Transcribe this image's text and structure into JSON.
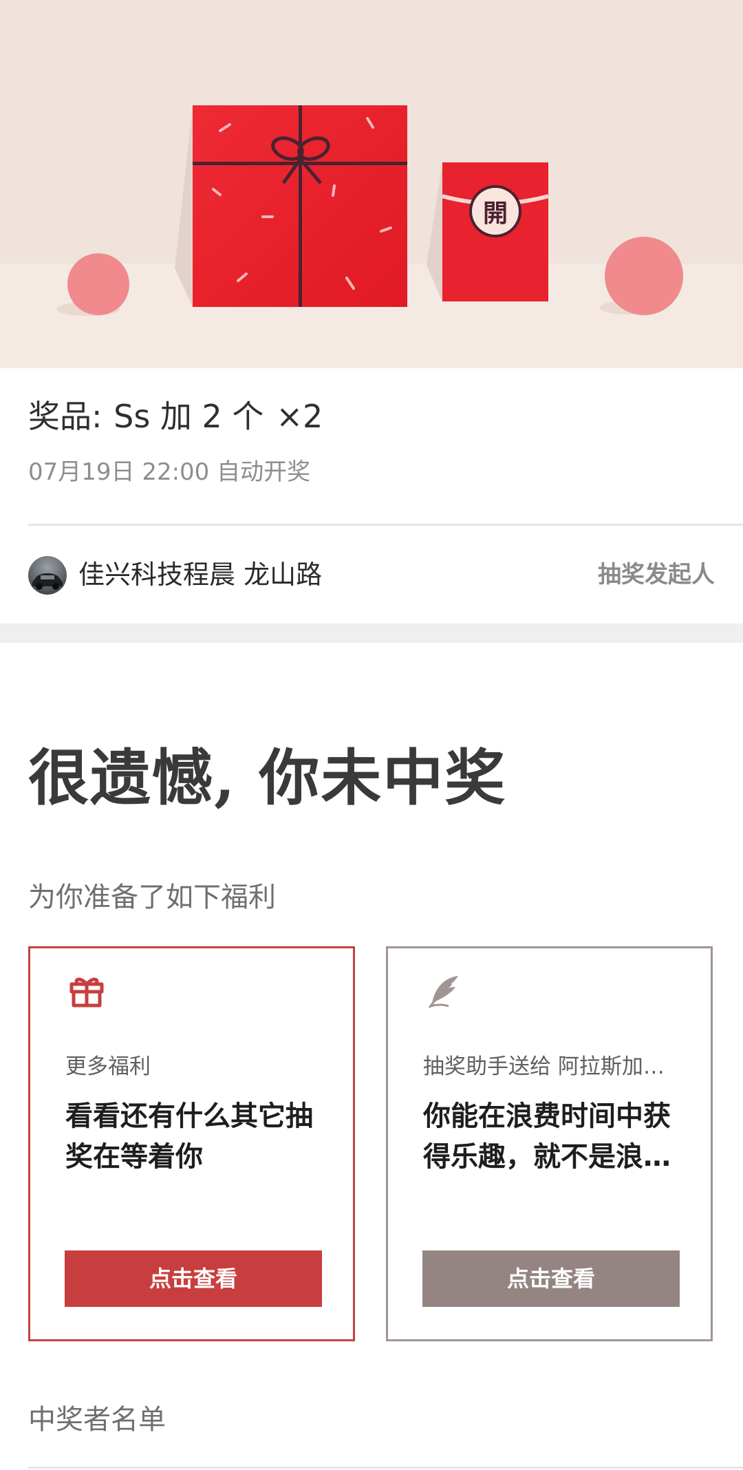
{
  "hero": {
    "red_packet_char": "開",
    "colors": {
      "background": "#efe3dc",
      "floor": "#f4e9e3",
      "gift_red": "#e8222e",
      "ribbon": "#4a2230",
      "ball_pink": "#f08a8c"
    }
  },
  "prize": {
    "label": "奖品",
    "separator": ":",
    "name": "Ss 加 2 个",
    "quantity": "×2",
    "draw_time": "07月19日 22:00 自动开奖"
  },
  "sponsor": {
    "name": "佳兴科技程晨 龙山路",
    "role": "抽奖发起人"
  },
  "result": {
    "heading": "很遗憾, 你未中奖",
    "benefits_subtitle": "为你准备了如下福利"
  },
  "cards": [
    {
      "icon": "gift-icon",
      "label": "更多福利",
      "description": "看看还有什么其它抽奖在等着你",
      "button": "点击查看",
      "accent": "#c83e3e"
    },
    {
      "icon": "feather-icon",
      "label": "抽奖助手送给 阿拉斯加…",
      "description": "你能在浪费时间中获得乐趣，就不是浪…",
      "button": "点击查看",
      "accent": "#948583"
    }
  ],
  "winners": {
    "title": "中奖者名单"
  }
}
